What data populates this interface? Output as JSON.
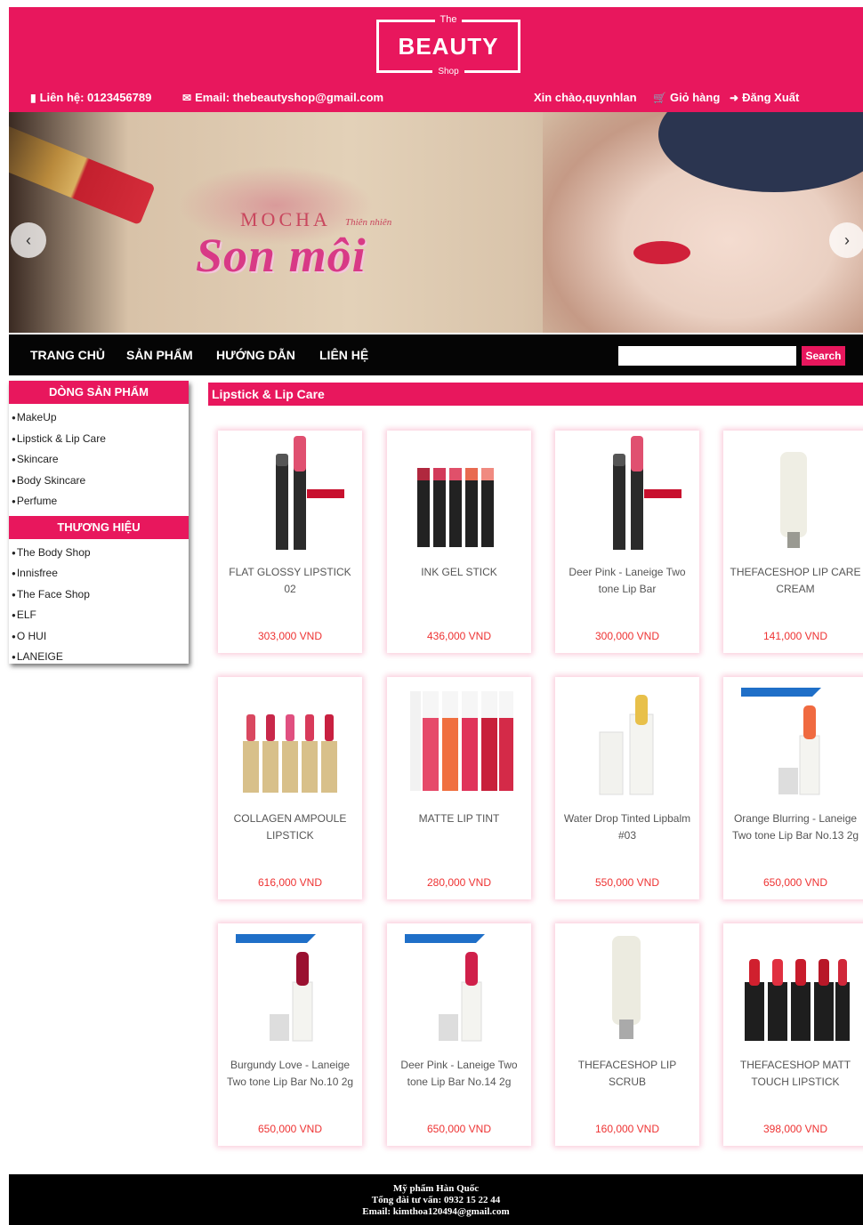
{
  "header": {
    "logo_top": "The",
    "logo_main": "BEAUTY",
    "logo_bottom": "Shop",
    "contact_label": "Liên hệ: 0123456789",
    "email_label": "Email: thebeautyshop@gmail.com",
    "greeting": "Xin chào,quynhlan",
    "cart_label": "Giỏ hàng",
    "logout_label": "Đăng Xuất"
  },
  "banner": {
    "brand": "MOCHA",
    "brand_sub": "Thiên nhiên",
    "headline": "Son môi",
    "prev_icon": "chevron-left-icon",
    "next_icon": "chevron-right-icon"
  },
  "nav": {
    "items": [
      "TRANG CHỦ",
      "SẢN PHẨM",
      "HƯỚNG DẪN",
      "LIÊN HỆ"
    ],
    "search_value": "",
    "search_button": "Search"
  },
  "sidebar": {
    "lines_title": "DÒNG SẢN PHẨM",
    "lines": [
      "MakeUp",
      "Lipstick & Lip Care",
      "Skincare",
      "Body Skincare",
      "Perfume"
    ],
    "brands_title": "THƯƠNG HIỆU",
    "brands": [
      "The Body Shop",
      "Innisfree",
      "The Face Shop",
      "ELF",
      "O HUI",
      "LANEIGE"
    ]
  },
  "category_title": "Lipstick & Lip Care",
  "products": [
    {
      "name": "FLAT GLOSSY LIPSTICK 02",
      "price": "303,000 VND"
    },
    {
      "name": "INK GEL STICK",
      "price": "436,000 VND"
    },
    {
      "name": "Deer Pink - Laneige Two tone Lip Bar",
      "price": "300,000 VND"
    },
    {
      "name": "THEFACESHOP LIP CARE CREAM",
      "price": "141,000 VND"
    },
    {
      "name": "COLLAGEN AMPOULE LIPSTICK",
      "price": "616,000 VND"
    },
    {
      "name": "MATTE LIP TINT",
      "price": "280,000 VND"
    },
    {
      "name": "Water Drop Tinted Lipbalm #03",
      "price": "550,000 VND"
    },
    {
      "name": "Orange Blurring - Laneige Two tone Lip Bar No.13 2g",
      "price": "650,000 VND"
    },
    {
      "name": "Burgundy Love - Laneige Two tone Lip Bar No.10 2g",
      "price": "650,000 VND"
    },
    {
      "name": "Deer Pink - Laneige Two tone Lip Bar No.14 2g",
      "price": "650,000 VND"
    },
    {
      "name": "THEFACESHOP LIP SCRUB",
      "price": "160,000 VND"
    },
    {
      "name": "THEFACESHOP MATT TOUCH LIPSTICK",
      "price": "398,000 VND"
    }
  ],
  "footer": {
    "line1": "Mỹ phẩm Hàn Quốc",
    "line2": "Tổng đài tư vấn: 0932 15 22 44",
    "line3": "Email: kimthoa120494@gmail.com"
  },
  "colors": {
    "accent": "#e8175d",
    "nav_bg": "#050505",
    "price": "#e33333"
  }
}
